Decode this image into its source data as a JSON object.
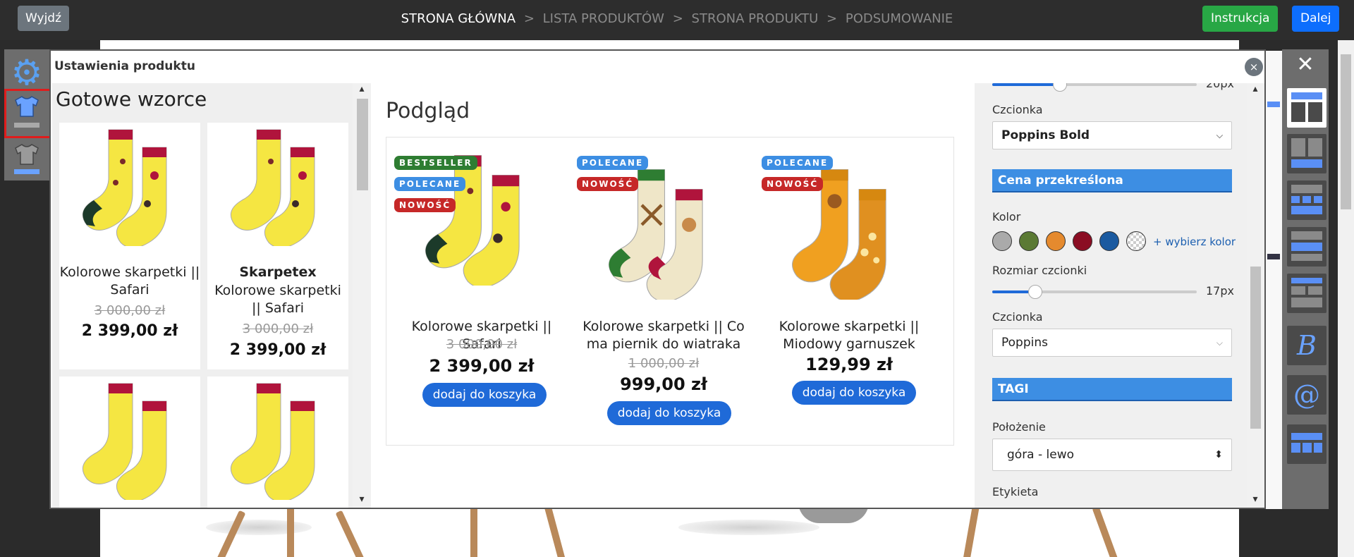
{
  "topbar": {
    "exit_label": "Wyjdź",
    "crumbs": [
      "STRONA GŁÓWNA",
      "LISTA PRODUKTÓW",
      "STRONA PRODUKTU",
      "PODSUMOWANIE"
    ],
    "crumb_sep": ">",
    "instruction_label": "Instrukcja",
    "next_label": "Dalej"
  },
  "modal": {
    "title": "Ustawienia produktu",
    "close_label": "×"
  },
  "templates": {
    "title": "Gotowe wzorce",
    "cards": [
      {
        "name": "Kolorowe skarpetki || Safari",
        "old_price": "3 000,00 zł",
        "price": "2 399,00 zł"
      },
      {
        "brand": "Skarpetex",
        "name": "Kolorowe skarpetki || Safari",
        "old_price": "3 000,00 zł",
        "price": "2 399,00 zł"
      }
    ]
  },
  "preview": {
    "title": "Podgląd",
    "products": [
      {
        "badges": [
          "BESTSELLER",
          "POLECANE",
          "NOWOŚĆ"
        ],
        "name": "Kolorowe skarpetki || Safari",
        "old_price": "3 000,00 zł",
        "price": "2 399,00 zł",
        "button": "dodaj do koszyka"
      },
      {
        "badges": [
          "POLECANE",
          "NOWOŚĆ"
        ],
        "name": "Kolorowe skarpetki || Co ma piernik do wiatraka",
        "old_price": "1 000,00 zł",
        "price": "999,00 zł",
        "button": "dodaj do koszyka"
      },
      {
        "badges": [
          "POLECANE",
          "NOWOŚĆ"
        ],
        "name": "Kolorowe skarpetki || Miodowy garnuszek",
        "old_price": "",
        "price": "129,99 zł",
        "button": "dodaj do koszyka"
      }
    ],
    "badge_colors": {
      "BESTSELLER": "#2e7d32",
      "POLECANE": "#3d8ee3",
      "NOWOŚĆ": "#c62828"
    }
  },
  "settings": {
    "top_slider_value": "20px",
    "font1_label": "Czcionka",
    "font1_value": "Poppins Bold",
    "section_strike": "Cena przekreślona",
    "color_label": "Kolor",
    "swatches": [
      "#aaaaaa",
      "#5b7a34",
      "#e58a2e",
      "#8b0d23",
      "#1b5aa0",
      "transparent"
    ],
    "pick_color": "+ wybierz kolor",
    "size_label": "Rozmiar czcionki",
    "size_value": "17px",
    "size_fraction": 0.21,
    "font2_label": "Czcionka",
    "font2_value": "Poppins",
    "section_tags": "TAGI",
    "position_label": "Położenie",
    "position_value": "góra - lewo",
    "label_label": "Etykieta"
  },
  "colors": {
    "accent": "#1f6ad8",
    "section": "#3d8ee3",
    "green": "#28a745"
  }
}
